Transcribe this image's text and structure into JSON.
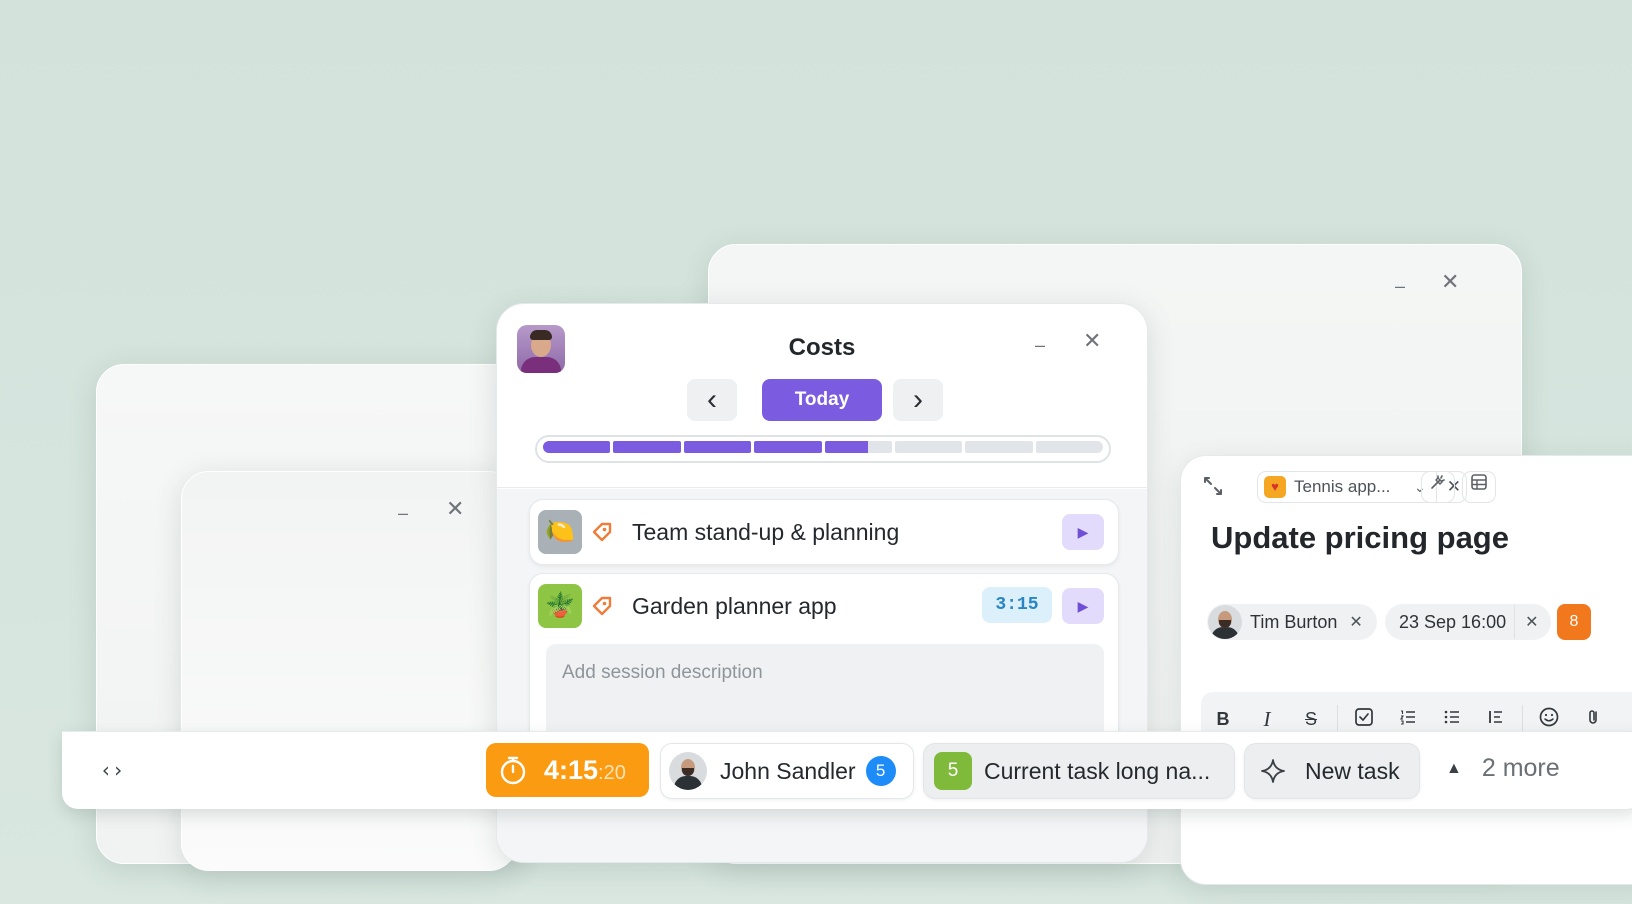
{
  "windows": {
    "back_left": {},
    "back_small": {
      "min_glyph": "–",
      "close_glyph": "✕"
    },
    "back_right": {
      "min_glyph": "–",
      "close_glyph": "✕"
    }
  },
  "costs": {
    "title": "Costs",
    "prev_glyph": "‹",
    "next_glyph": "›",
    "today_label": "Today",
    "min_glyph": "–",
    "close_glyph": "✕",
    "progress_fraction": 0.58,
    "progress_segments": 8,
    "entries": [
      {
        "name": "Team stand-up & planning",
        "icon": "lemon",
        "icon_glyph": "🍋",
        "time": ""
      },
      {
        "name": "Garden planner app",
        "icon": "plant-pot",
        "icon_glyph": "🪴",
        "time": "3:15"
      }
    ],
    "description_placeholder": "Add session description",
    "play_glyph": "▶"
  },
  "task": {
    "project_name": "Tennis app...",
    "title": "Update pricing page",
    "assignee": "Tim Burton",
    "due": "23 Sep 16:00",
    "badge": "8",
    "x_glyph": "✕",
    "chevron_glyph": "⌄",
    "toolbar": {
      "bold": "B",
      "italic": "I",
      "strike": "S"
    }
  },
  "bottombar": {
    "code_glyph": "‹›",
    "timer_main": "4:15",
    "timer_seconds": ":20",
    "user_name": "John Sandler",
    "user_count": "5",
    "current_task_number": "5",
    "current_task": "Current task long na...",
    "new_task_label": "New task",
    "more_glyph": "▲",
    "more_label": "2 more"
  },
  "colors": {
    "accent_purple": "#7b5be0",
    "timer_orange": "#fb9b12",
    "badge_blue": "#1d8cf8",
    "task_orange": "#f2781e",
    "green": "#7fba3a"
  }
}
